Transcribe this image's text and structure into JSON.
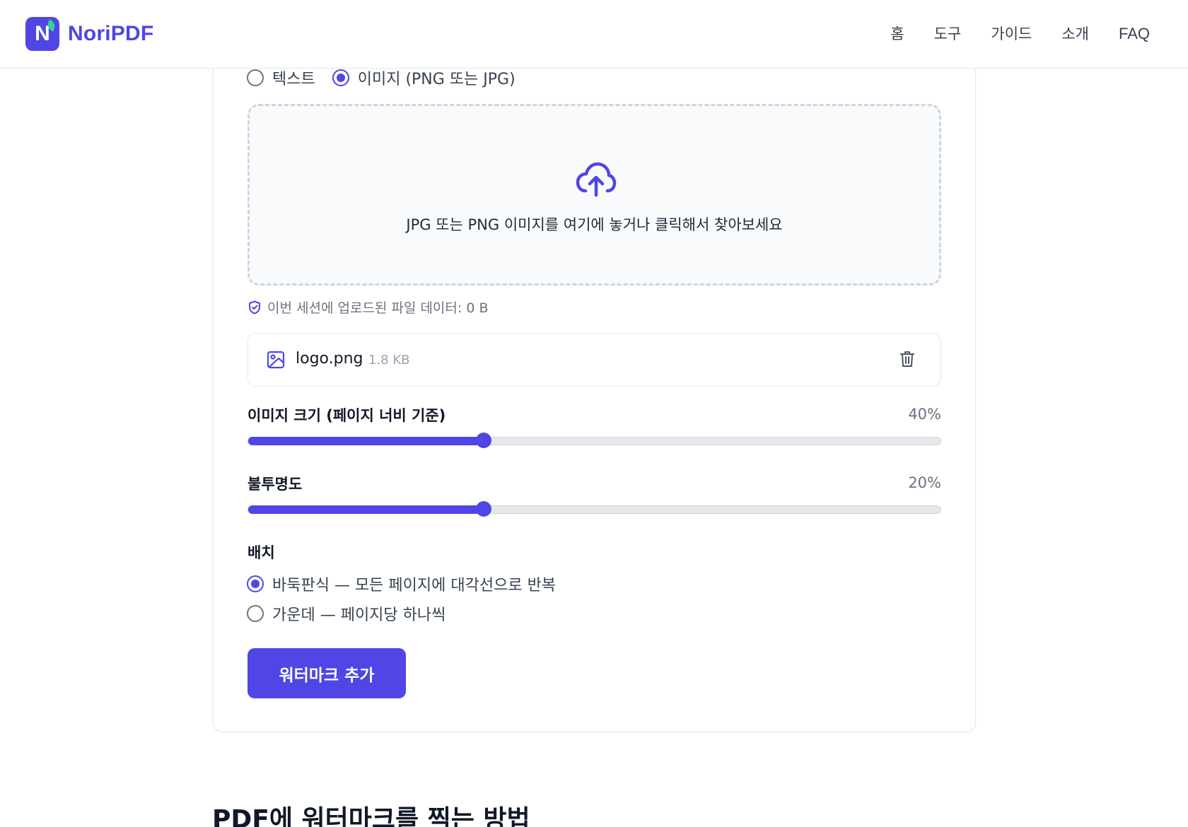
{
  "brand": {
    "name": "NoriPDF",
    "logo_letter": "N"
  },
  "nav": {
    "items": [
      "홈",
      "도구",
      "가이드",
      "소개",
      "FAQ"
    ]
  },
  "watermark_type": {
    "options": [
      {
        "label": "텍스트",
        "selected": false
      },
      {
        "label": "이미지 (PNG 또는 JPG)",
        "selected": true
      }
    ]
  },
  "dropzone": {
    "icon": "cloud-upload-icon",
    "text": "JPG 또는 PNG 이미지를 여기에 놓거나 클릭해서 찾아보세요"
  },
  "session": {
    "icon": "shield-check-icon",
    "text": "이번 세션에 업로드된 파일 데이터: 0 B"
  },
  "file": {
    "icon": "image-icon",
    "name": "logo.png",
    "size": "1.8 KB",
    "delete_icon": "trash-icon"
  },
  "image_size": {
    "label": "이미지 크기 (페이지 너비 기준)",
    "value_text": "40%",
    "fraction": 0.34
  },
  "opacity": {
    "label": "불투명도",
    "value_text": "20%",
    "fraction": 0.34
  },
  "placement": {
    "label": "배치",
    "options": [
      {
        "label": "바둑판식 — 모든 페이지에 대각선으로 반복",
        "selected": true
      },
      {
        "label": "가운데 — 페이지당 하나씩",
        "selected": false
      }
    ]
  },
  "submit": {
    "label": "워터마크 추가"
  },
  "next_section": {
    "heading": "PDF에 워터마크를 찍는 방법"
  },
  "colors": {
    "accent": "#4f46e5",
    "leaf": "#34d399",
    "border": "#e5e7eb",
    "dropzone_bg": "#f8fafc"
  }
}
